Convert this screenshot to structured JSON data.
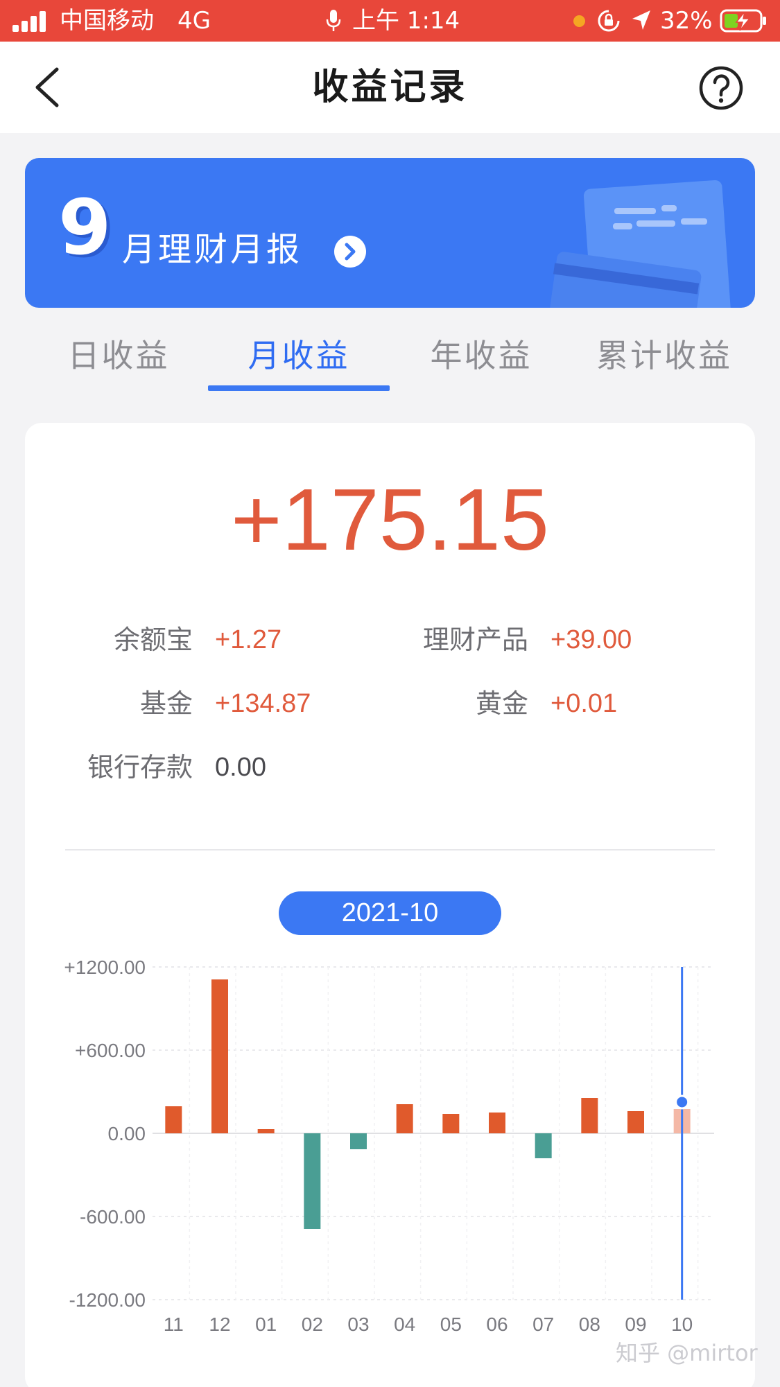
{
  "status_bar": {
    "carrier": "中国移动",
    "network": "4G",
    "time": "上午 1:14",
    "battery": "32%"
  },
  "header": {
    "title": "收益记录"
  },
  "banner": {
    "month": "9",
    "title": "月理财月报"
  },
  "tabs": [
    {
      "label": "日收益",
      "active": false
    },
    {
      "label": "月收益",
      "active": true
    },
    {
      "label": "年收益",
      "active": false
    },
    {
      "label": "累计收益",
      "active": false
    }
  ],
  "summary": {
    "total": "+175.15",
    "breakdown": [
      {
        "label": "余额宝",
        "value": "+1.27"
      },
      {
        "label": "理财产品",
        "value": "+39.00"
      },
      {
        "label": "基金",
        "value": "+134.87"
      },
      {
        "label": "黄金",
        "value": "+0.01"
      },
      {
        "label": "银行存款",
        "value": "0.00"
      }
    ]
  },
  "selected_month": "2021-10",
  "colors": {
    "accent": "#3b78f3",
    "positive": "#e05a3c",
    "negative": "#4a9e94",
    "status_bar": "#e8473a"
  },
  "chart_data": {
    "type": "bar",
    "categories": [
      "11",
      "12",
      "01",
      "02",
      "03",
      "04",
      "05",
      "06",
      "07",
      "08",
      "09",
      "10"
    ],
    "values": [
      195,
      1110,
      30,
      -690,
      -115,
      210,
      140,
      150,
      -180,
      255,
      160,
      175.15
    ],
    "ylim": [
      -1200,
      1200
    ],
    "yticks": [
      1200,
      600,
      0,
      -600,
      -1200
    ],
    "ytick_labels": [
      "+1200.00",
      "+600.00",
      "0.00",
      "-600.00",
      "-1200.00"
    ],
    "grid": true,
    "highlighted_category": "10"
  },
  "watermark": "知乎 @mirtor"
}
